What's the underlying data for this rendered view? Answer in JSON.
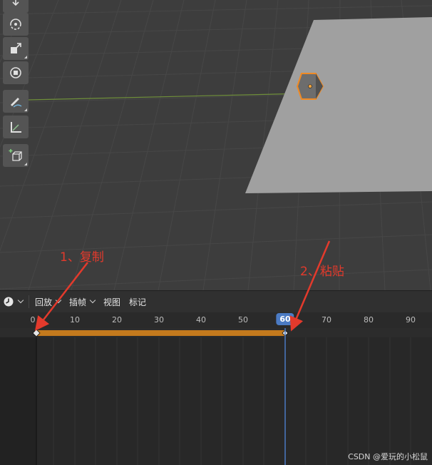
{
  "timeline": {
    "editor_type_icon": "clock-icon",
    "menu": {
      "playback": "回放",
      "keying": "插帧",
      "view": "视图",
      "marker": "标记"
    },
    "ruler_labels": [
      "0",
      "10",
      "20",
      "30",
      "40",
      "50",
      "70",
      "80",
      "90"
    ],
    "current_frame": "60",
    "keyframe_start": 0,
    "keyframe_end": 60
  },
  "annotations": {
    "copy_label": "1、复制",
    "paste_label": "2、粘贴"
  },
  "watermark": "CSDN @爱玩的小松鼠",
  "colors": {
    "viewport_bg": "#3d3d3d",
    "plane": "#a0a0a0",
    "selection_orange": "#f08a24",
    "keyframe_bar": "#c47a1d",
    "playhead_blue": "#4b7bc4",
    "annotation_red": "#e33a2c"
  },
  "toolbar": {
    "tools": [
      "move-icon",
      "rotate-icon",
      "scale-icon",
      "transform-icon",
      "annotate-icon",
      "measure-icon",
      "add-cube-icon"
    ]
  }
}
